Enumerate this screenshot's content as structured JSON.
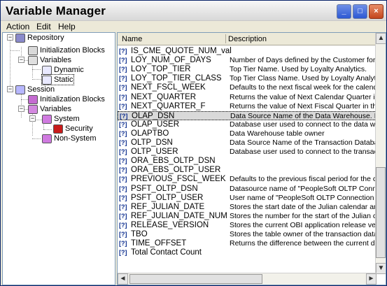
{
  "window": {
    "title": "Variable Manager",
    "controls": {
      "minimize": "_",
      "maximize": "□",
      "close": "×"
    }
  },
  "menu": {
    "items": [
      "Action",
      "Edit",
      "Help"
    ]
  },
  "tree": {
    "items": [
      {
        "label": "Repository",
        "level": 0
      },
      {
        "label": "Initialization Blocks",
        "level": 1
      },
      {
        "label": "Variables",
        "level": 1
      },
      {
        "label": "Dynamic",
        "level": 2
      },
      {
        "label": "Static",
        "level": 2
      },
      {
        "label": "Session",
        "level": 0
      },
      {
        "label": "Initialization Blocks",
        "level": 1
      },
      {
        "label": "Variables",
        "level": 1
      },
      {
        "label": "System",
        "level": 2
      },
      {
        "label": "Security",
        "level": 3
      },
      {
        "label": "Non-System",
        "level": 2
      }
    ]
  },
  "table": {
    "columns": [
      "Name",
      "Description"
    ],
    "rows": [
      {
        "name": "IS_CME_QUOTE_NUM_val",
        "description": ""
      },
      {
        "name": "LOY_NUM_OF_DAYS",
        "description": "Number of Days defined by the Customer for Inactiv"
      },
      {
        "name": "LOY_TOP_TIER",
        "description": "Top Tier Name.   Used by Loyalty Analytics."
      },
      {
        "name": "LOY_TOP_TIER_CLASS",
        "description": "Top Tier Class Name.   Used by Loyalty Analytics."
      },
      {
        "name": "NEXT_FSCL_WEEK",
        "description": "Defaults to the next fiscal week for the calendar as"
      },
      {
        "name": "NEXT_QUARTER",
        "description": "Returns the value of Next Calendar Quarter in the 'Y"
      },
      {
        "name": "NEXT_QUARTER_F",
        "description": "Returns the value of Next Fiscal Quarter in the 'YYY"
      },
      {
        "name": "OLAP_DSN",
        "description": "Data Source Name of the Data Warehouse.  It is u"
      },
      {
        "name": "OLAP_USER",
        "description": "Database user used to connect to the data wareho"
      },
      {
        "name": "OLAPTBO",
        "description": "Data Warehouse table owner"
      },
      {
        "name": "OLTP_DSN",
        "description": "Data Source Name of the Transaction Database."
      },
      {
        "name": "OLTP_USER",
        "description": "Database user used to connect to the transaction d"
      },
      {
        "name": "ORA_EBS_OLTP_DSN",
        "description": ""
      },
      {
        "name": "ORA_EBS_OLTP_USER",
        "description": ""
      },
      {
        "name": "PREVIOUS_FSCL_WEEK",
        "description": "Defaults to the previous fiscal period for the calendar"
      },
      {
        "name": "PSFT_OLTP_DSN",
        "description": "Datasource name of \"PeopleSoft OLTP Connection"
      },
      {
        "name": "PSFT_OLTP_USER",
        "description": "User name of \"PeopleSoft OLTP Connection Pool\""
      },
      {
        "name": "REF_JULIAN_DATE",
        "description": "Stores the start date of the Julian calendar and sho"
      },
      {
        "name": "REF_JULIAN_DATE_NUM",
        "description": "Stores the number for the start of the Julian calenda"
      },
      {
        "name": "RELEASE_VERSION",
        "description": "Stores the current OBI application release version."
      },
      {
        "name": "TBO",
        "description": "Stores the table owner of the transaction database"
      },
      {
        "name": "TIME_OFFSET",
        "description": "Returns the difference between the current date an"
      },
      {
        "name": "Total Contact Count",
        "description": ""
      }
    ],
    "row_icon": "[?]",
    "selected_index": 7
  },
  "colors": {
    "titlebar": "#d8d8d8",
    "chrome": "#ece9d8",
    "selection": "#d9d9d9",
    "icon": "#0e2f8f"
  }
}
